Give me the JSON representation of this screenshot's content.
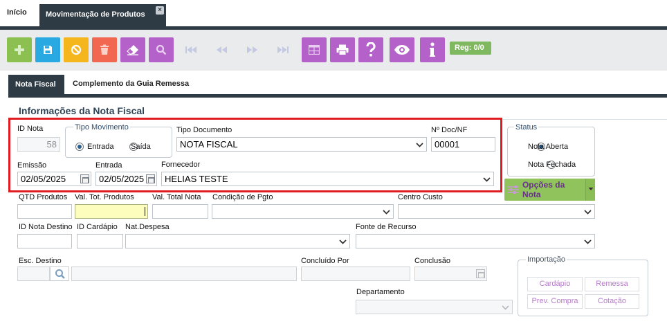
{
  "tabs": {
    "home": "Início",
    "active": "Movimentação de Produtos"
  },
  "toolbar": {
    "reg_counter": "Reg: 0/0",
    "colors": {
      "add": "#8cc152",
      "save": "#29a9e1",
      "cancel": "#f5b51c",
      "delete": "#f26750",
      "purple": "#b462c9"
    }
  },
  "subtabs": {
    "nota_fiscal": "Nota Fiscal",
    "complemento": "Complemento da Guia Remessa"
  },
  "section": {
    "title": "Informações da Nota Fiscal"
  },
  "form": {
    "id_nota": {
      "label": "ID Nota",
      "value": "58"
    },
    "tipo_movimento": {
      "legend": "Tipo Movimento",
      "entrada": "Entrada",
      "saida": "Saída",
      "selected": "Entrada"
    },
    "tipo_documento": {
      "label": "Tipo Documento",
      "value": "NOTA FISCAL"
    },
    "num_doc": {
      "label": "Nº Doc/NF",
      "value": "00001"
    },
    "emissao": {
      "label": "Emissão",
      "value": "02/05/2025"
    },
    "entrada": {
      "label": "Entrada",
      "value": "02/05/2025"
    },
    "fornecedor": {
      "label": "Fornecedor",
      "value": "HELIAS TESTE"
    },
    "status": {
      "legend": "Status",
      "aberta": "Nota Aberta",
      "fechada": "Nota Fechada",
      "selected": "Nota Aberta"
    },
    "opcoes_label": "Opções da Nota",
    "qtd_produtos": {
      "label": "QTD Produtos",
      "value": ""
    },
    "val_tot_produtos": {
      "label": "Val. Tot. Produtos",
      "value": ""
    },
    "val_total_nota": {
      "label": "Val. Total Nota",
      "value": ""
    },
    "condicao_pgto": {
      "label": "Condição de Pgto",
      "value": ""
    },
    "centro_custo": {
      "label": "Centro Custo",
      "value": ""
    },
    "id_nota_destino": {
      "label": "ID Nota Destino",
      "value": ""
    },
    "id_cardapio": {
      "label": "ID Cardápio",
      "value": ""
    },
    "nat_despesa": {
      "label": "Nat.Despesa",
      "value": ""
    },
    "fonte_recurso": {
      "label": "Fonte de Recurso",
      "value": ""
    },
    "esc_destino": {
      "label": "Esc. Destino",
      "value": ""
    },
    "concluido_por": {
      "label": "Concluído Por",
      "value": ""
    },
    "conclusao": {
      "label": "Conclusão",
      "value": ""
    },
    "departamento": {
      "label": "Departamento",
      "value": ""
    },
    "importacao": {
      "legend": "Importação",
      "cardapio": "Cardápio",
      "remessa": "Remessa",
      "prev_compra": "Prev. Compra",
      "cotacao": "Cotação"
    }
  }
}
